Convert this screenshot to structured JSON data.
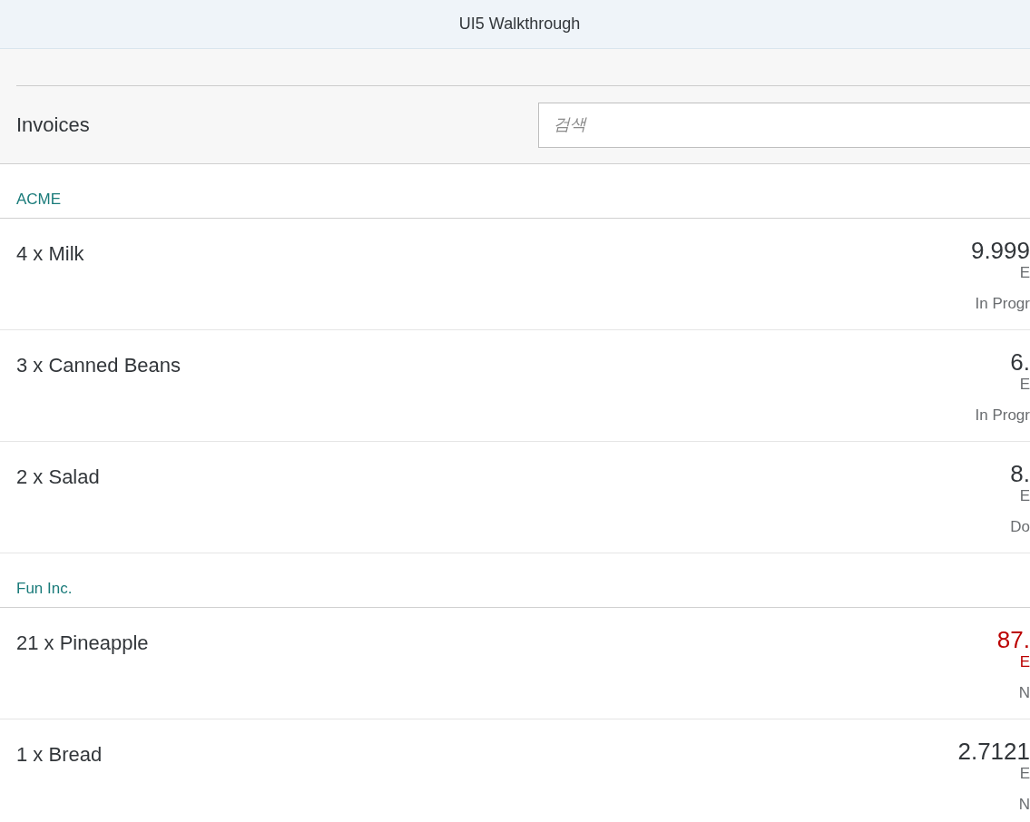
{
  "shell": {
    "title": "UI5 Walkthrough"
  },
  "list": {
    "title": "Invoices",
    "search": {
      "placeholder": "검색"
    },
    "groups": [
      {
        "name": "ACME",
        "items": [
          {
            "title": "4 x Milk",
            "price": "9.999",
            "currency": "E",
            "status": "In Progr",
            "error": false
          },
          {
            "title": "3 x Canned Beans",
            "price": "6.",
            "currency": "E",
            "status": "In Progr",
            "error": false
          },
          {
            "title": "2 x Salad",
            "price": "8.",
            "currency": "E",
            "status": "Do",
            "error": false
          }
        ]
      },
      {
        "name": "Fun Inc.",
        "items": [
          {
            "title": "21 x Pineapple",
            "price": "87.",
            "currency": "E",
            "status": "N",
            "error": true
          },
          {
            "title": "1 x Bread",
            "price": "2.7121",
            "currency": "E",
            "status": "N",
            "error": false
          }
        ]
      }
    ]
  }
}
